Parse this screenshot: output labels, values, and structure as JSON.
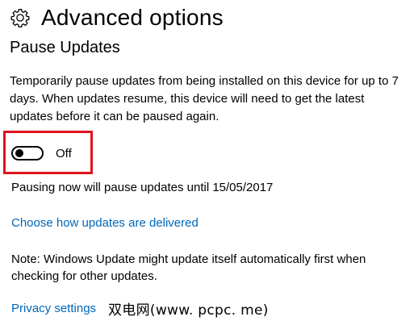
{
  "header": {
    "title": "Advanced options",
    "icon": "gear-icon"
  },
  "pause_updates": {
    "section_title": "Pause Updates",
    "description": "Temporarily pause updates from being installed on this device for up to 7 days. When updates resume, this device will need to get the latest updates before it can be paused again.",
    "toggle_state": "Off",
    "toggle_on": false,
    "pause_info": "Pausing now will pause updates until 15/05/2017"
  },
  "links": {
    "delivery": "Choose how updates are delivered",
    "privacy": "Privacy settings"
  },
  "note": "Note: Windows Update might update itself automatically first when checking for other updates.",
  "watermark": "双电网(www. pcpc. me)",
  "colors": {
    "link": "#0067b8",
    "highlight": "#e0141e"
  }
}
